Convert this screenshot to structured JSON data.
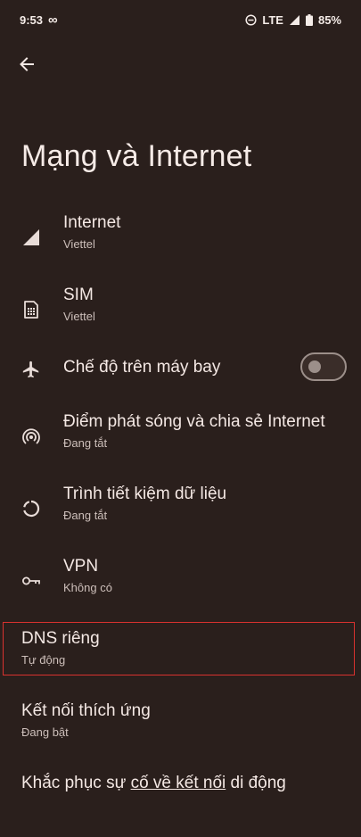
{
  "status_bar": {
    "time": "9:53",
    "network": "LTE",
    "battery": "85%"
  },
  "header": {
    "title": "Mạng và Internet"
  },
  "items": [
    {
      "title": "Internet",
      "summary": "Viettel",
      "icon": "signal-icon"
    },
    {
      "title": "SIM",
      "summary": "Viettel",
      "icon": "sim-card-icon"
    },
    {
      "title": "Chế độ trên máy bay",
      "summary": "",
      "icon": "airplane-icon",
      "toggle": "off"
    },
    {
      "title": "Điểm phát sóng và chia sẻ Internet",
      "summary": "Đang tắt",
      "icon": "hotspot-icon"
    },
    {
      "title": "Trình tiết kiệm dữ liệu",
      "summary": "Đang tắt",
      "icon": "data-saver-icon"
    },
    {
      "title": "VPN",
      "summary": "Không có",
      "icon": "vpn-key-icon"
    },
    {
      "title": "DNS riêng",
      "summary": "Tự động"
    },
    {
      "title": "Kết nối thích ứng",
      "summary": "Đang bật"
    },
    {
      "title_parts": [
        "Khắc phục sự ",
        "cố về kết nối",
        " di động"
      ]
    }
  ],
  "colors": {
    "background": "#2a1f1c",
    "highlight_border": "#d9322f"
  }
}
